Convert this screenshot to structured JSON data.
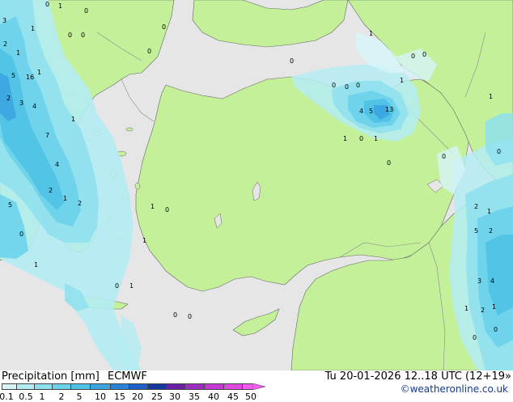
{
  "legend": {
    "title": "Precipitation [mm]",
    "model": "ECMWF",
    "valid": "Tu 20-01-2026 12..18 UTC (12+19»",
    "credit": "©weatheronline.co.uk",
    "ticks": [
      "0.1",
      "0.5",
      "1",
      "2",
      "5",
      "10",
      "15",
      "20",
      "25",
      "30",
      "35",
      "40",
      "45",
      "50"
    ],
    "colors": [
      "#d6f4f8",
      "#b4ecf3",
      "#8fe0ee",
      "#6cd3ea",
      "#4fc2e6",
      "#3ba5e0",
      "#2a83d6",
      "#1f5fc8",
      "#14399f",
      "#6a1fa6",
      "#9b2ec0",
      "#c43ad2",
      "#e04ae0",
      "#f25cf0"
    ]
  },
  "colors": {
    "sea": "#e6e6e6",
    "land": "#c4f09a",
    "border": "#8a8a8a",
    "coast": "#666666"
  },
  "map_values": [
    {
      "v": "0"
    },
    {
      "v": "1"
    },
    {
      "v": "0"
    },
    {
      "v": "3"
    },
    {
      "v": "1"
    },
    {
      "v": "0"
    },
    {
      "v": "0"
    },
    {
      "v": "2"
    },
    {
      "v": "1"
    },
    {
      "v": "5"
    },
    {
      "v": "16"
    },
    {
      "v": "1"
    },
    {
      "v": "2"
    },
    {
      "v": "3"
    },
    {
      "v": "4"
    },
    {
      "v": "1"
    },
    {
      "v": "7"
    },
    {
      "v": "4"
    },
    {
      "v": "5"
    },
    {
      "v": "2"
    },
    {
      "v": "1"
    },
    {
      "v": "2"
    },
    {
      "v": "0"
    },
    {
      "v": "1"
    },
    {
      "v": "0"
    },
    {
      "v": "0"
    },
    {
      "v": "0"
    },
    {
      "v": "1"
    },
    {
      "v": "0"
    },
    {
      "v": "0"
    },
    {
      "v": "1"
    },
    {
      "v": "0"
    },
    {
      "v": "4"
    },
    {
      "v": "5"
    },
    {
      "v": "13"
    },
    {
      "v": "0"
    },
    {
      "v": "0"
    },
    {
      "v": "1"
    },
    {
      "v": "0"
    },
    {
      "v": "1"
    },
    {
      "v": "0"
    },
    {
      "v": "0"
    },
    {
      "v": "1"
    },
    {
      "v": "0"
    },
    {
      "v": "2"
    },
    {
      "v": "1"
    },
    {
      "v": "5"
    },
    {
      "v": "2"
    },
    {
      "v": "3"
    },
    {
      "v": "4"
    },
    {
      "v": "1"
    },
    {
      "v": "2"
    },
    {
      "v": "1"
    },
    {
      "v": "0"
    },
    {
      "v": "0"
    },
    {
      "v": "1"
    },
    {
      "v": "1"
    },
    {
      "v": "0"
    },
    {
      "v": "0"
    },
    {
      "v": "0"
    },
    {
      "v": "1"
    },
    {
      "v": "0"
    }
  ]
}
